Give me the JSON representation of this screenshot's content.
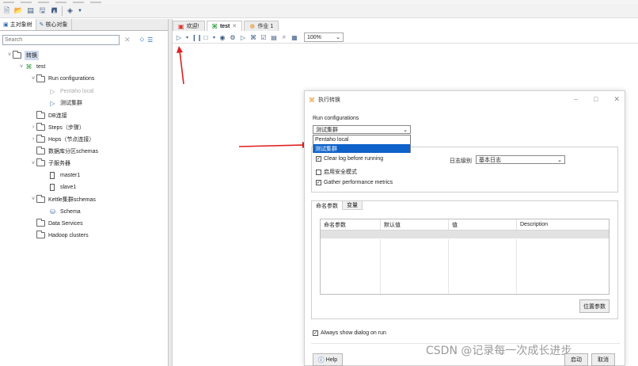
{
  "left_panel": {
    "tabs": [
      "主对象树",
      "核心对象"
    ],
    "search_placeholder": "Search",
    "tree": [
      {
        "label": "转换",
        "level": 0,
        "icon": "folder",
        "chevron": "v",
        "selected": true
      },
      {
        "label": "test",
        "level": 1,
        "icon": "transform",
        "chevron": "v"
      },
      {
        "label": "Run configurations",
        "level": 2,
        "icon": "folder",
        "chevron": "v"
      },
      {
        "label": "Pentaho local",
        "level": 3,
        "icon": "play-gray",
        "chevron": "",
        "muted": true
      },
      {
        "label": "测试集群",
        "level": 3,
        "icon": "play",
        "chevron": ""
      },
      {
        "label": "DB连接",
        "level": 2,
        "icon": "folder",
        "chevron": ""
      },
      {
        "label": "Steps（步骤）",
        "level": 2,
        "icon": "folder",
        "chevron": ">"
      },
      {
        "label": "Hops（节点连接）",
        "level": 2,
        "icon": "folder",
        "chevron": ">"
      },
      {
        "label": "数据库分区schemas",
        "level": 2,
        "icon": "folder",
        "chevron": ""
      },
      {
        "label": "子服务器",
        "level": 2,
        "icon": "folder",
        "chevron": "v"
      },
      {
        "label": "master1",
        "level": 3,
        "icon": "server",
        "chevron": ""
      },
      {
        "label": "slave1",
        "level": 3,
        "icon": "server",
        "chevron": ""
      },
      {
        "label": "Kettle集群schemas",
        "level": 2,
        "icon": "folder",
        "chevron": "v"
      },
      {
        "label": "Schema",
        "level": 3,
        "icon": "cluster",
        "chevron": ""
      },
      {
        "label": "Data Services",
        "level": 2,
        "icon": "folder",
        "chevron": ""
      },
      {
        "label": "Hadoop clusters",
        "level": 2,
        "icon": "folder",
        "chevron": ""
      }
    ]
  },
  "editor": {
    "tabs": [
      {
        "label": "欢迎!",
        "icon": "welcome"
      },
      {
        "label": "test",
        "icon": "transform",
        "active": true
      },
      {
        "label": "作业 1",
        "icon": "job"
      }
    ],
    "zoom": "100%"
  },
  "dialog": {
    "title": "执行转换",
    "run_config_label": "Run configurations",
    "run_config_value": "测试集群",
    "run_config_options": [
      "Pentaho local",
      "测试集群"
    ],
    "run_config_selected_index": 1,
    "clear_log_label": "Clear log before running",
    "log_level_label": "日志级别",
    "log_level_value": "基本日志",
    "safe_mode_label": "启用安全模式",
    "gather_metrics_label": "Gather performance metrics",
    "param_tabs": [
      "命名参数",
      "变量"
    ],
    "param_columns": [
      "命名参数",
      "默认值",
      "值",
      "Description"
    ],
    "reset_button": "位置参数",
    "always_show_label": "Always show dialog on run",
    "help_button": "Help",
    "run_button": "启动",
    "cancel_button": "取消"
  },
  "watermark": "CSDN @记录每一次成长进步",
  "colors": {
    "highlight": "#0e62c9",
    "arrow": "#e02020"
  }
}
